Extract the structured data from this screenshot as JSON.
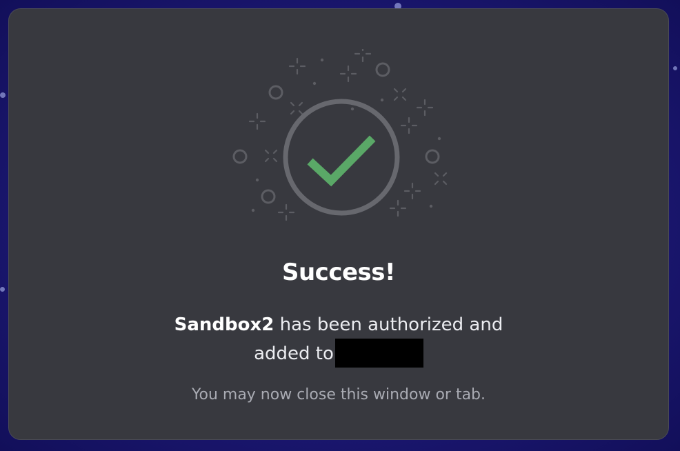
{
  "dialog": {
    "title": "Success!",
    "message": {
      "bot_name": "Sandbox2",
      "line1_rest": " has been authorized and",
      "line2": "added to",
      "server_name_redacted": true
    },
    "hint": "You may now close this window or tab."
  },
  "icons": {
    "status": "checkmark-circle-icon",
    "decorations": [
      "sparkle-icon",
      "small-ring-icon",
      "x-sparkle-icon",
      "dot-icon"
    ]
  },
  "colors": {
    "page_background": "#1c1873",
    "dialog_background": "#38393f",
    "check_green": "#5aa867",
    "ring_gray": "#67686e",
    "decoration_gray": "#5c5d63",
    "title_text": "#ffffff",
    "body_text": "#ecedf1",
    "hint_text": "#a9abb3",
    "redaction": "#000000"
  }
}
